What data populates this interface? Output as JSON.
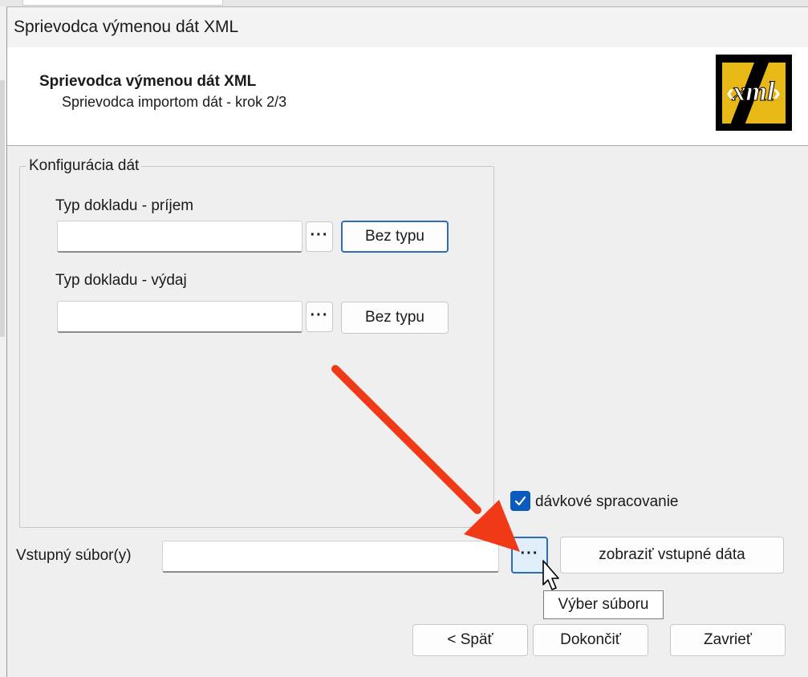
{
  "window": {
    "title": "Sprievodca výmenou dát XML"
  },
  "header": {
    "title": "Sprievodca výmenou dát XML",
    "subtitle": "Sprievodca importom dát - krok 2/3",
    "logo_text": "‹xml›"
  },
  "config_group": {
    "legend": "Konfigurácia dát",
    "income": {
      "label": "Typ dokladu - príjem",
      "value": "",
      "browse_label": "···",
      "clear_label": "Bez typu"
    },
    "expense": {
      "label": "Typ dokladu - výdaj",
      "value": "",
      "browse_label": "···",
      "clear_label": "Bez typu"
    }
  },
  "batch": {
    "label": "dávkové spracovanie",
    "checked": true
  },
  "input_file": {
    "label": "Vstupný súbor(y)",
    "value": "",
    "browse_label": "···",
    "show_data_label": "zobraziť vstupné dáta"
  },
  "tooltip": {
    "text": "Výber súboru"
  },
  "footer": {
    "back_label": "< Späť",
    "finish_label": "Dokončiť",
    "close_label": "Zavrieť"
  },
  "colors": {
    "accent": "#2f6db8",
    "checkbox": "#0a5bbd",
    "annotation_arrow": "#f03a17"
  }
}
